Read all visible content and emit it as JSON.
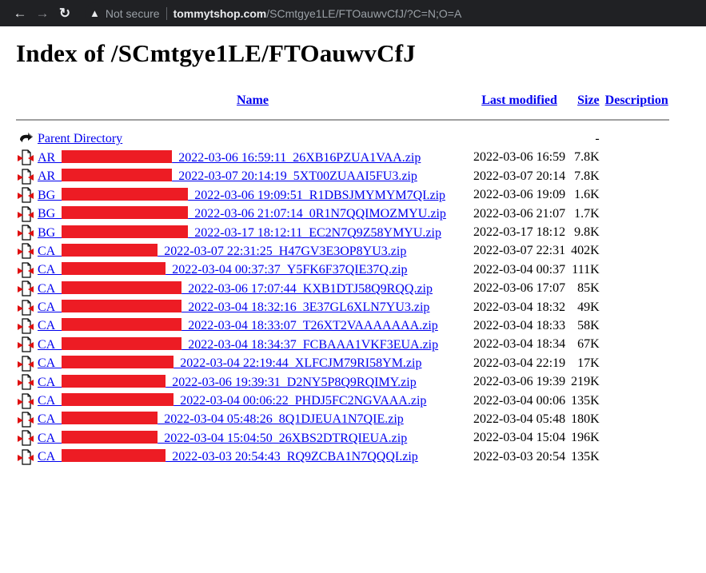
{
  "browser": {
    "security_label": "Not secure",
    "url_host": "tommytshop.com",
    "url_path": "/SCmtgye1LE/FTOauwvCfJ/?C=N;O=A",
    "back_icon": "arrow-left-icon",
    "forward_icon": "arrow-right-icon",
    "reload_icon": "reload-icon"
  },
  "page": {
    "title": "Index of /SCmtgye1LE/FTOauwvCfJ"
  },
  "table": {
    "headers": {
      "name": "Name",
      "last_modified": "Last modified",
      "size": "Size",
      "description": "Description"
    },
    "parent": {
      "label": "Parent Directory",
      "size": "-",
      "icon": "back-arrow-icon"
    },
    "redaction_color": "#ed1c24",
    "rows": [
      {
        "prefix": "AR_",
        "suffix": "_2022-03-06 16:59:11_26XB16PZUA1VAA.zip",
        "modified": "2022-03-06 16:59",
        "size": "7.8K"
      },
      {
        "prefix": "AR_",
        "suffix": "_2022-03-07 20:14:19_5XT00ZUAAI5FU3.zip",
        "modified": "2022-03-07 20:14",
        "size": "7.8K"
      },
      {
        "prefix": "BG_",
        "suffix": "_2022-03-06 19:09:51_R1DBSJMYMYM7QI.zip",
        "modified": "2022-03-06 19:09",
        "size": "1.6K"
      },
      {
        "prefix": "BG_",
        "suffix": "_2022-03-06 21:07:14_0R1N7QQIMOZMYU.zip",
        "modified": "2022-03-06 21:07",
        "size": "1.7K"
      },
      {
        "prefix": "BG_",
        "suffix": "_2022-03-17 18:12:11_EC2N7Q9Z58YMYU.zip",
        "modified": "2022-03-17 18:12",
        "size": "9.8K"
      },
      {
        "prefix": "CA_",
        "suffix": "_2022-03-07 22:31:25_H47GV3E3OP8YU3.zip",
        "modified": "2022-03-07 22:31",
        "size": "402K"
      },
      {
        "prefix": "CA_",
        "suffix": "_2022-03-04 00:37:37_Y5FK6F37QIE37Q.zip",
        "modified": "2022-03-04 00:37",
        "size": "111K"
      },
      {
        "prefix": "CA_",
        "suffix": "_2022-03-06 17:07:44_KXB1DTJ58Q9RQQ.zip",
        "modified": "2022-03-06 17:07",
        "size": "85K"
      },
      {
        "prefix": "CA_",
        "suffix": "_2022-03-04 18:32:16_3E37GL6XLN7YU3.zip",
        "modified": "2022-03-04 18:32",
        "size": "49K"
      },
      {
        "prefix": "CA_",
        "suffix": "_2022-03-04 18:33:07_T26XT2VAAAAAAA.zip",
        "modified": "2022-03-04 18:33",
        "size": "58K"
      },
      {
        "prefix": "CA_",
        "suffix": "_2022-03-04 18:34:37_FCBAAA1VKF3EUA.zip",
        "modified": "2022-03-04 18:34",
        "size": "67K"
      },
      {
        "prefix": "CA_",
        "suffix": "_2022-03-04 22:19:44_XLFCJM79RI58YM.zip",
        "modified": "2022-03-04 22:19",
        "size": "17K"
      },
      {
        "prefix": "CA_",
        "suffix": "_2022-03-06 19:39:31_D2NY5P8Q9RQIMY.zip",
        "modified": "2022-03-06 19:39",
        "size": "219K"
      },
      {
        "prefix": "CA_",
        "suffix": "_2022-03-04 00:06:22_PHDJ5FC2NGVAAA.zip",
        "modified": "2022-03-04 00:06",
        "size": "135K"
      },
      {
        "prefix": "CA_",
        "suffix": "_2022-03-04 05:48:26_8Q1DJEUA1N7QIE.zip",
        "modified": "2022-03-04 05:48",
        "size": "180K"
      },
      {
        "prefix": "CA_",
        "suffix": "_2022-03-04 15:04:50_26XBS2DTRQIEUA.zip",
        "modified": "2022-03-04 15:04",
        "size": "196K"
      },
      {
        "prefix": "CA_",
        "suffix": "_2022-03-03 20:54:43_RQ9ZCBA1N7QQQI.zip",
        "modified": "2022-03-03 20:54",
        "size": "135K"
      }
    ]
  }
}
